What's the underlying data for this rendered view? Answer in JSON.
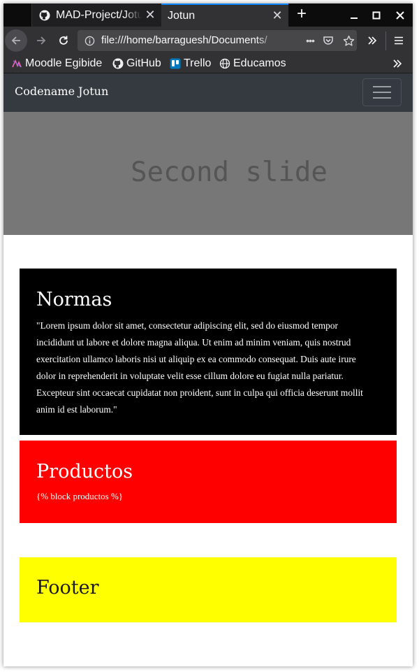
{
  "browser": {
    "tabs": [
      {
        "title": "MAD-Project/Jotun",
        "active": false,
        "icon": "github-icon"
      },
      {
        "title": "Jotun",
        "active": true
      }
    ],
    "new_tab": "+",
    "address": {
      "url": "file:///home/barraguesh/Documents/",
      "page_actions": "•••"
    },
    "bookmarks": [
      {
        "label": "Moodle Egibide",
        "icon": "moodle-icon"
      },
      {
        "label": "GitHub",
        "icon": "github-icon"
      },
      {
        "label": "Trello",
        "icon": "trello-icon"
      },
      {
        "label": "Educamos",
        "icon": "globe-icon"
      }
    ],
    "colors": {
      "accent": "#0a84ff",
      "toolbar": "#323234",
      "tabstrip": "#0c0c0d"
    }
  },
  "site": {
    "brand": "Codename Jotun",
    "carousel": {
      "slide_text": "Second slide"
    },
    "sections": {
      "normas": {
        "title": "Normas",
        "text": "\"Lorem ipsum dolor sit amet, consectetur adipiscing elit, sed do eiusmod tempor incididunt ut labore et dolore magna aliqua. Ut enim ad minim veniam, quis nostrud exercitation ullamco laboris nisi ut aliquip ex ea commodo consequat. Duis aute irure dolor in reprehenderit in voluptate velit esse cillum dolore eu fugiat nulla pariatur. Excepteur sint occaecat cupidatat non proident, sunt in culpa qui officia deserunt mollit anim id est laborum.\"",
        "color": "#000000"
      },
      "productos": {
        "title": "Productos",
        "text": "{% block productos %}",
        "color": "#ff0000"
      },
      "footer": {
        "title": "Footer",
        "color": "#ffff00"
      }
    }
  }
}
